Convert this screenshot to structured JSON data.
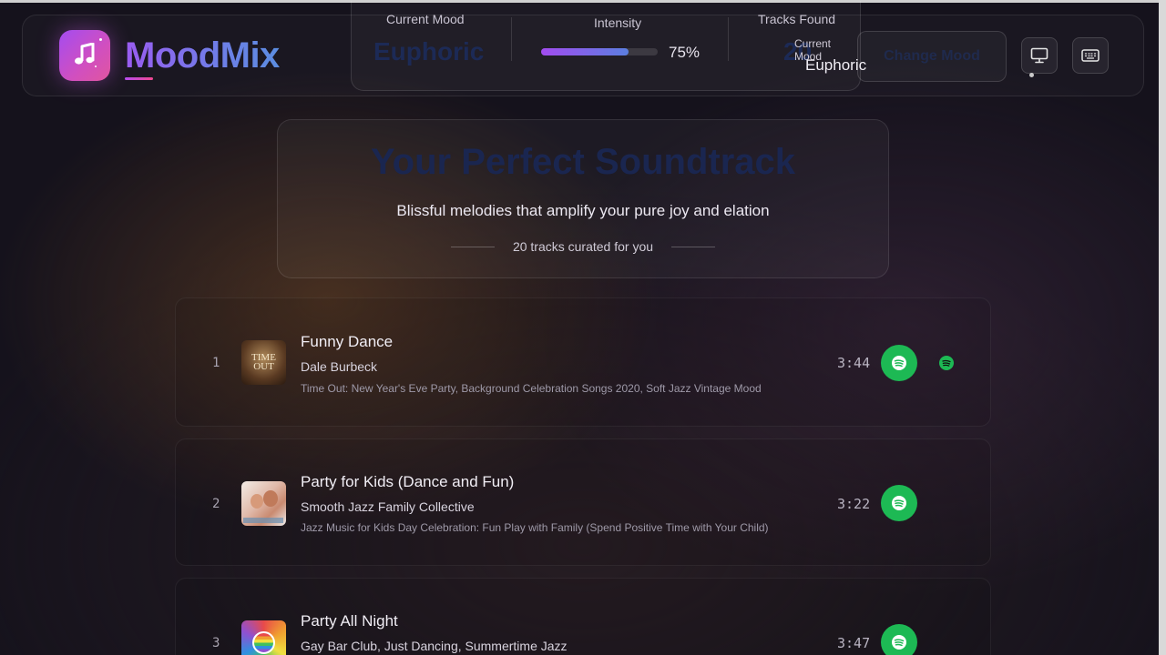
{
  "app": {
    "name": "MoodMix"
  },
  "stats": {
    "current_mood_label": "Current Mood",
    "current_mood_value": "Euphoric",
    "intensity_label": "Intensity",
    "intensity_value": 0.75,
    "intensity_text": "75%",
    "tracks_found_label": "Tracks Found",
    "tracks_found_value": "20"
  },
  "mood_badge": {
    "label": "Current Mood",
    "value": "Euphoric"
  },
  "actions": {
    "change_mood": "Change Mood"
  },
  "hero": {
    "title": "Your Perfect Soundtrack",
    "subtitle": "Blissful melodies that amplify your pure joy and elation",
    "count_text": "20 tracks curated for you"
  },
  "tracks": [
    {
      "num": "1",
      "title": "Funny Dance",
      "artist": "Dale Burbeck",
      "album": "Time Out: New Year's Eve Party, Background Celebration Songs 2020, Soft Jazz Vintage Mood",
      "duration": "3:44",
      "art_text": "TIME OUT"
    },
    {
      "num": "2",
      "title": "Party for Kids (Dance and Fun)",
      "artist": "Smooth Jazz Family Collective",
      "album": "Jazz Music for Kids Day Celebration: Fun Play with Family (Spend Positive Time with Your Child)",
      "duration": "3:22"
    },
    {
      "num": "3",
      "title": "Party All Night",
      "artist": "Gay Bar Club, Just Dancing, Summertime Jazz",
      "album": "",
      "duration": "3:47"
    }
  ],
  "icons": {
    "logo": "music-note-icon",
    "display": "monitor-icon",
    "keyboard": "keyboard-icon",
    "spotify": "spotify-icon"
  },
  "colors": {
    "accent": "#a44cf0",
    "spotify": "#1db954",
    "background": "#15121c"
  }
}
